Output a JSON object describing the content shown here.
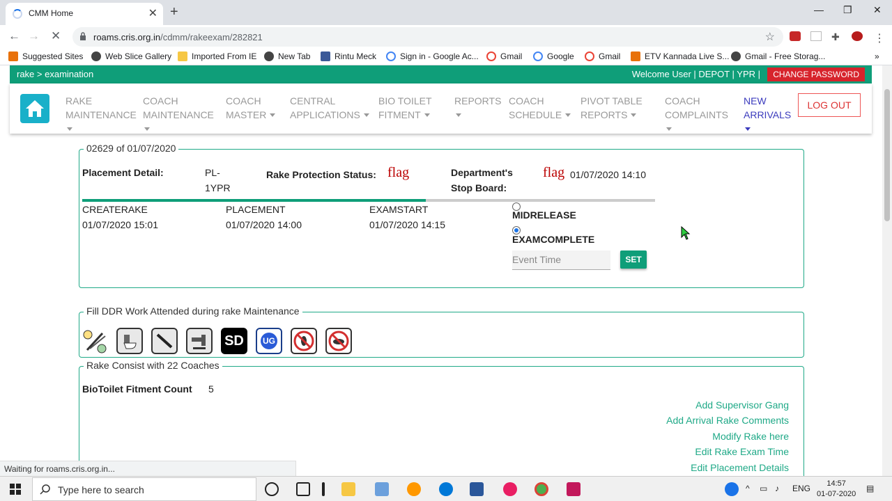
{
  "browser": {
    "tab_title": "CMM Home",
    "url_host": "roams.cris.org.in",
    "url_path": "/cdmm/rakeexam/282821",
    "bookmarks": [
      "Suggested Sites",
      "Web Slice Gallery",
      "Imported From IE",
      "New Tab",
      "Rintu Meck",
      "Sign in - Google Ac...",
      "Gmail",
      "Google",
      "Gmail",
      "ETV Kannada Live S...",
      "Gmail - Free Storag..."
    ]
  },
  "header": {
    "breadcrumb": "rake > examination",
    "welcome": "Welcome User | DEPOT | YPR |",
    "change_password": "CHANGE PASSWORD"
  },
  "nav": {
    "items": [
      {
        "line1": "RAKE",
        "line2": "MAINTENANCE"
      },
      {
        "line1": "COACH",
        "line2": "MAINTENANCE"
      },
      {
        "line1": "COACH",
        "line2": "MASTER"
      },
      {
        "line1": "CENTRAL",
        "line2": "APPLICATIONS"
      },
      {
        "line1": "BIO TOILET",
        "line2": "FITMENT"
      },
      {
        "line1": "REPORTS",
        "line2": ""
      },
      {
        "line1": "COACH",
        "line2": "SCHEDULE"
      },
      {
        "line1": "PIVOT TABLE",
        "line2": "REPORTS"
      },
      {
        "line1": "COACH",
        "line2": "COMPLAINTS"
      },
      {
        "line1": "NEW",
        "line2": "ARRIVALS"
      }
    ],
    "logout": "LOG OUT"
  },
  "rake": {
    "legend": "02629 of 01/07/2020",
    "placement_label": "Placement Detail:",
    "placement_value_1": "PL-",
    "placement_value_2": "1YPR",
    "protection_label": "Rake Protection Status:",
    "flag_text": "flag",
    "dept_label_1": "Department's",
    "dept_label_2": "Stop Board:",
    "dept_flag": "flag",
    "dept_time": "01/07/2020 14:10",
    "progress": 0.6,
    "events": [
      {
        "name": "CREATERAKE",
        "time": "01/07/2020 15:01"
      },
      {
        "name": "PLACEMENT",
        "time": "01/07/2020 14:00"
      },
      {
        "name": "EXAMSTART",
        "time": "01/07/2020 14:15"
      }
    ],
    "options": [
      "MIDRELEASE",
      "EXAMCOMPLETE"
    ],
    "selected_option": "EXAMCOMPLETE",
    "event_time_placeholder": "Event Time",
    "set_label": "SET"
  },
  "ddr": {
    "legend": "Fill DDR Work Attended during rake Maintenance",
    "icons": [
      "wrench-icon",
      "toilet-icon",
      "tool-icon",
      "tap-icon",
      "sd-icon",
      "ug-icon",
      "no-insect-icon",
      "no-rat-icon"
    ],
    "sd_text": "SD",
    "ug_text": "UG"
  },
  "consist": {
    "legend": "Rake Consist with 22 Coaches",
    "fitment_label": "BioToilet Fitment Count",
    "fitment_value": "5",
    "links": [
      "Add Supervisor Gang",
      "Add Arrival Rake Comments",
      "Modify Rake here",
      "Edit Rake Exam Time",
      "Edit Placement Details"
    ]
  },
  "status_text": "Waiting for roams.cris.org.in...",
  "taskbar": {
    "search_placeholder": "Type here to search",
    "lang": "ENG",
    "time": "14:57",
    "date": "01-07-2020"
  }
}
